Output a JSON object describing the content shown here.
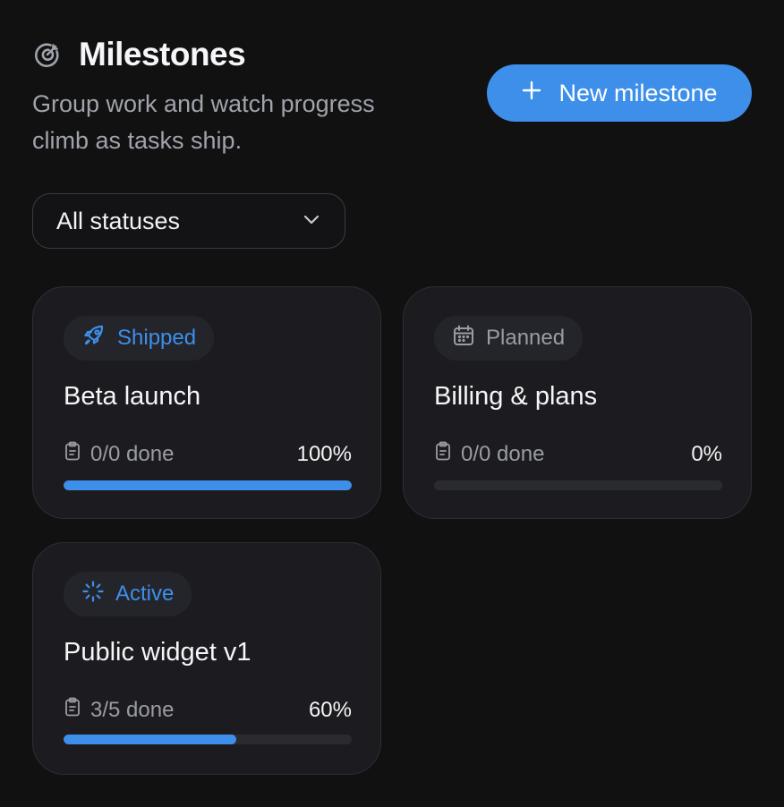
{
  "header": {
    "title": "Milestones",
    "title_icon": "target-icon",
    "subtitle": "Group work and watch progress climb as tasks ship.",
    "new_button_label": "New milestone",
    "new_button_icon": "plus-icon"
  },
  "filter": {
    "selected": "All statuses",
    "icon": "chevron-down-icon"
  },
  "colors": {
    "background": "#111112",
    "card": "#1c1c20",
    "accent": "#3d8fea",
    "muted_text": "#9a9ca4"
  },
  "milestones": [
    {
      "status": "Shipped",
      "status_icon": "rocket-icon",
      "title": "Beta launch",
      "tasks": "0/0 done",
      "percent_label": "100%",
      "progress": 1.0
    },
    {
      "status": "Planned",
      "status_icon": "calendar-icon",
      "title": "Billing & plans",
      "tasks": "0/0 done",
      "percent_label": "0%",
      "progress": 0.0
    },
    {
      "status": "Active",
      "status_icon": "loader-icon",
      "title": "Public widget v1",
      "tasks": "3/5 done",
      "percent_label": "60%",
      "progress": 0.6
    }
  ]
}
